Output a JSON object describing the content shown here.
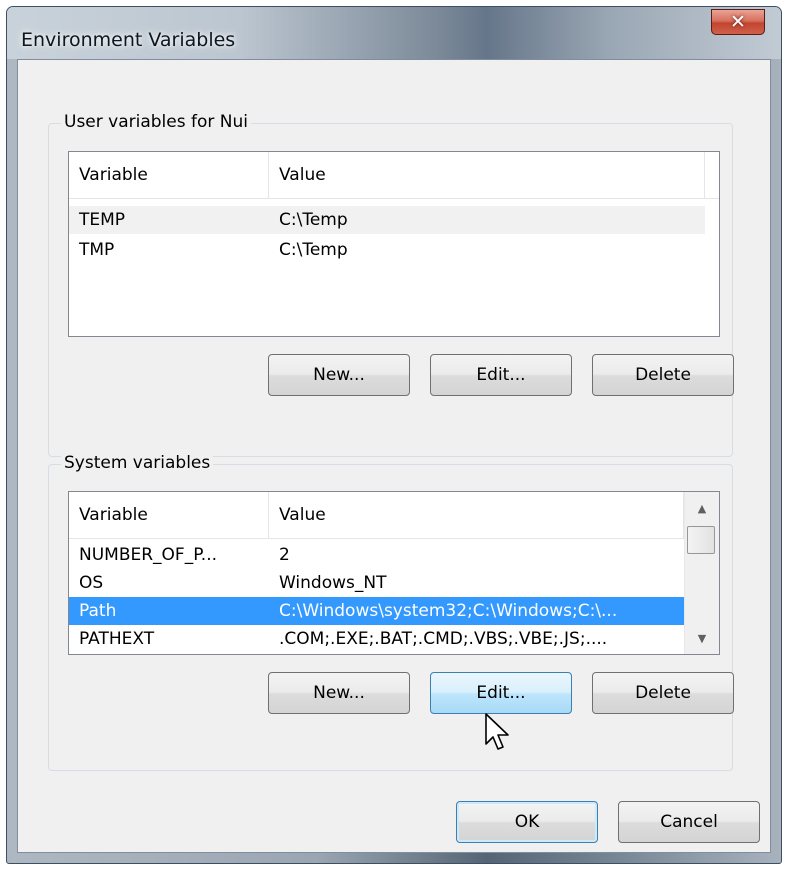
{
  "window": {
    "title": "Environment Variables",
    "close_symbol": "✕"
  },
  "user_group": {
    "legend": "User variables for Nui",
    "columns": [
      "Variable",
      "Value"
    ],
    "rows": [
      {
        "variable": "TEMP",
        "value": "C:\\Temp"
      },
      {
        "variable": "TMP",
        "value": "C:\\Temp"
      }
    ],
    "buttons": {
      "new": "New...",
      "edit": "Edit...",
      "delete": "Delete"
    }
  },
  "system_group": {
    "legend": "System variables",
    "columns": [
      "Variable",
      "Value"
    ],
    "rows": [
      {
        "variable": "NUMBER_OF_P...",
        "value": "2"
      },
      {
        "variable": "OS",
        "value": "Windows_NT"
      },
      {
        "variable": "Path",
        "value": "C:\\Windows\\system32;C:\\Windows;C:\\..."
      },
      {
        "variable": "PATHEXT",
        "value": ".COM;.EXE;.BAT;.CMD;.VBS;.VBE;.JS;...."
      }
    ],
    "selected_row": "Path",
    "buttons": {
      "new": "New...",
      "edit": "Edit...",
      "delete": "Delete"
    }
  },
  "footer": {
    "ok": "OK",
    "cancel": "Cancel"
  },
  "colors": {
    "selection": "#3399ff",
    "button_hot": "#bee6fd",
    "close_button": "#c24530"
  },
  "icons": {
    "close": "close-icon",
    "scroll_up": "scroll-up-arrow-icon",
    "scroll_down": "scroll-down-arrow-icon",
    "cursor": "mouse-pointer-icon"
  }
}
